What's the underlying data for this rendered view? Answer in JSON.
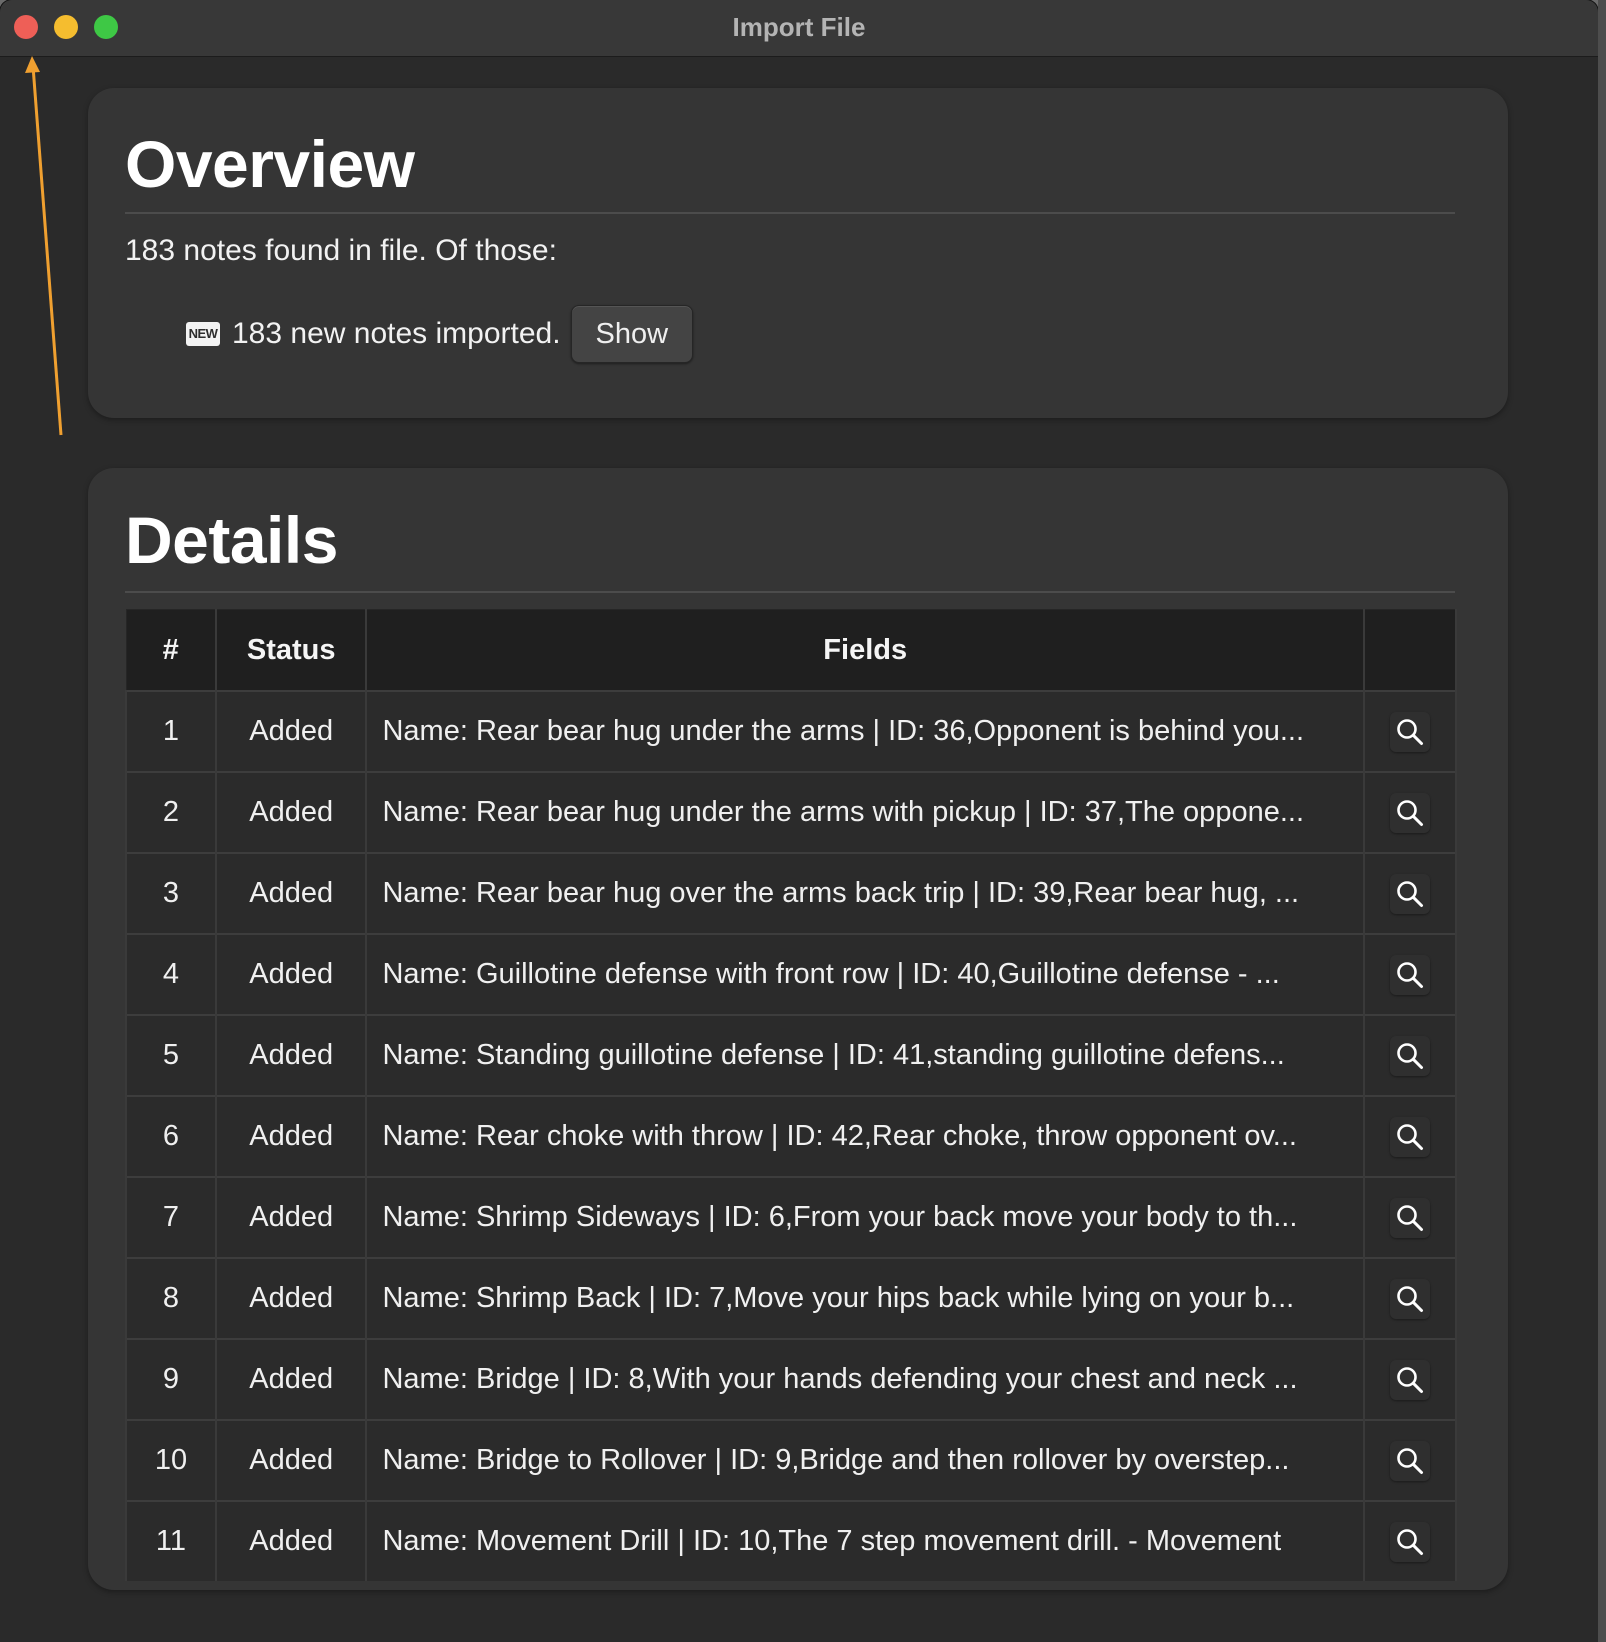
{
  "window": {
    "title": "Import File"
  },
  "overview": {
    "heading": "Overview",
    "summary": "183 notes found in file. Of those:",
    "new_badge": "NEW",
    "new_text": "183 new notes imported.",
    "show_label": "Show"
  },
  "details": {
    "heading": "Details",
    "columns": [
      "#",
      "Status",
      "Fields",
      ""
    ],
    "rows": [
      {
        "num": "1",
        "status": "Added",
        "fields": "Name: Rear bear hug under the arms | ID: 36,Opponent is behind you..."
      },
      {
        "num": "2",
        "status": "Added",
        "fields": "Name: Rear bear hug under the arms with pickup | ID: 37,The oppone..."
      },
      {
        "num": "3",
        "status": "Added",
        "fields": "Name: Rear bear hug over the arms back trip | ID: 39,Rear bear hug, ..."
      },
      {
        "num": "4",
        "status": "Added",
        "fields": "Name: Guillotine defense with front row | ID: 40,Guillotine defense - ..."
      },
      {
        "num": "5",
        "status": "Added",
        "fields": "Name: Standing guillotine defense | ID: 41,standing guillotine defens..."
      },
      {
        "num": "6",
        "status": "Added",
        "fields": "Name: Rear choke with throw | ID: 42,Rear choke, throw opponent ov..."
      },
      {
        "num": "7",
        "status": "Added",
        "fields": "Name: Shrimp Sideways | ID: 6,From your back move your body to th..."
      },
      {
        "num": "8",
        "status": "Added",
        "fields": "Name: Shrimp Back | ID: 7,Move your hips back while lying on your b..."
      },
      {
        "num": "9",
        "status": "Added",
        "fields": "Name: Bridge | ID: 8,With your hands defending your chest and neck ..."
      },
      {
        "num": "10",
        "status": "Added",
        "fields": "Name: Bridge to Rollover | ID: 9,Bridge and then rollover by overstep..."
      },
      {
        "num": "11",
        "status": "Added",
        "fields": "Name: Movement Drill | ID: 10,The 7 step movement drill. - Movement"
      }
    ],
    "row_action_icon": "magnifier-icon"
  },
  "colors": {
    "annotation_arrow": "#f0a030",
    "close": "#ee5f57",
    "minimize": "#f5bd2f",
    "maximize": "#3ec845"
  }
}
